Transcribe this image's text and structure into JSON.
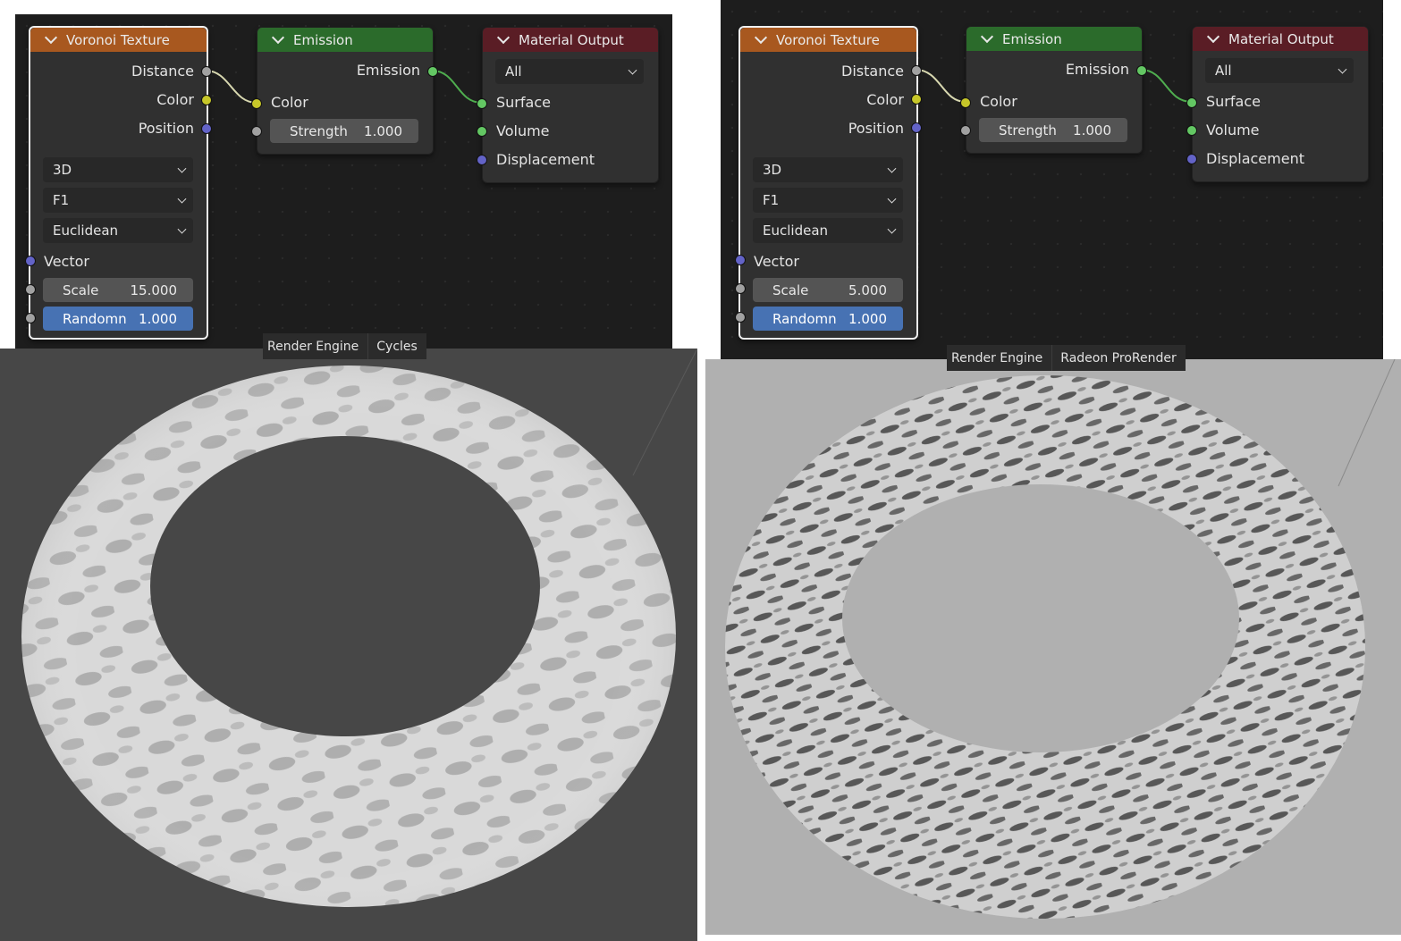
{
  "panels": [
    {
      "id": "left",
      "voronoi": {
        "title": "Voronoi Texture",
        "outputs": {
          "distance": "Distance",
          "color": "Color",
          "position": "Position"
        },
        "dimensions": "3D",
        "feature": "F1",
        "metric": "Euclidean",
        "vector_label": "Vector",
        "scale_label": "Scale",
        "scale_value": "15.000",
        "randomness_label": "Randomn",
        "randomness_value": "1.000"
      },
      "emission": {
        "title": "Emission",
        "output_label": "Emission",
        "color_label": "Color",
        "strength_label": "Strength",
        "strength_value": "1.000"
      },
      "output": {
        "title": "Material Output",
        "target": "All",
        "surface": "Surface",
        "volume": "Volume",
        "displacement": "Displacement"
      },
      "render_engine_label": "Render Engine",
      "render_engine_value": "Cycles",
      "viewport_bg": "#474747"
    },
    {
      "id": "right",
      "voronoi": {
        "title": "Voronoi Texture",
        "outputs": {
          "distance": "Distance",
          "color": "Color",
          "position": "Position"
        },
        "dimensions": "3D",
        "feature": "F1",
        "metric": "Euclidean",
        "vector_label": "Vector",
        "scale_label": "Scale",
        "scale_value": "5.000",
        "randomness_label": "Randomn",
        "randomness_value": "1.000"
      },
      "emission": {
        "title": "Emission",
        "output_label": "Emission",
        "color_label": "Color",
        "strength_label": "Strength",
        "strength_value": "1.000"
      },
      "output": {
        "title": "Material Output",
        "target": "All",
        "surface": "Surface",
        "volume": "Volume",
        "displacement": "Displacement"
      },
      "render_engine_label": "Render Engine",
      "render_engine_value": "Radeon ProRender",
      "viewport_bg": "#b0b0b0"
    }
  ],
  "colors": {
    "voronoi_header": "#a8581f",
    "emission_header": "#2b6b2b",
    "output_header": "#5a1d25",
    "socket_grey": "#a1a1a1",
    "socket_yellow": "#c7c729",
    "socket_blue": "#6363c7",
    "socket_green": "#63c763",
    "active_field": "#4772b3"
  }
}
